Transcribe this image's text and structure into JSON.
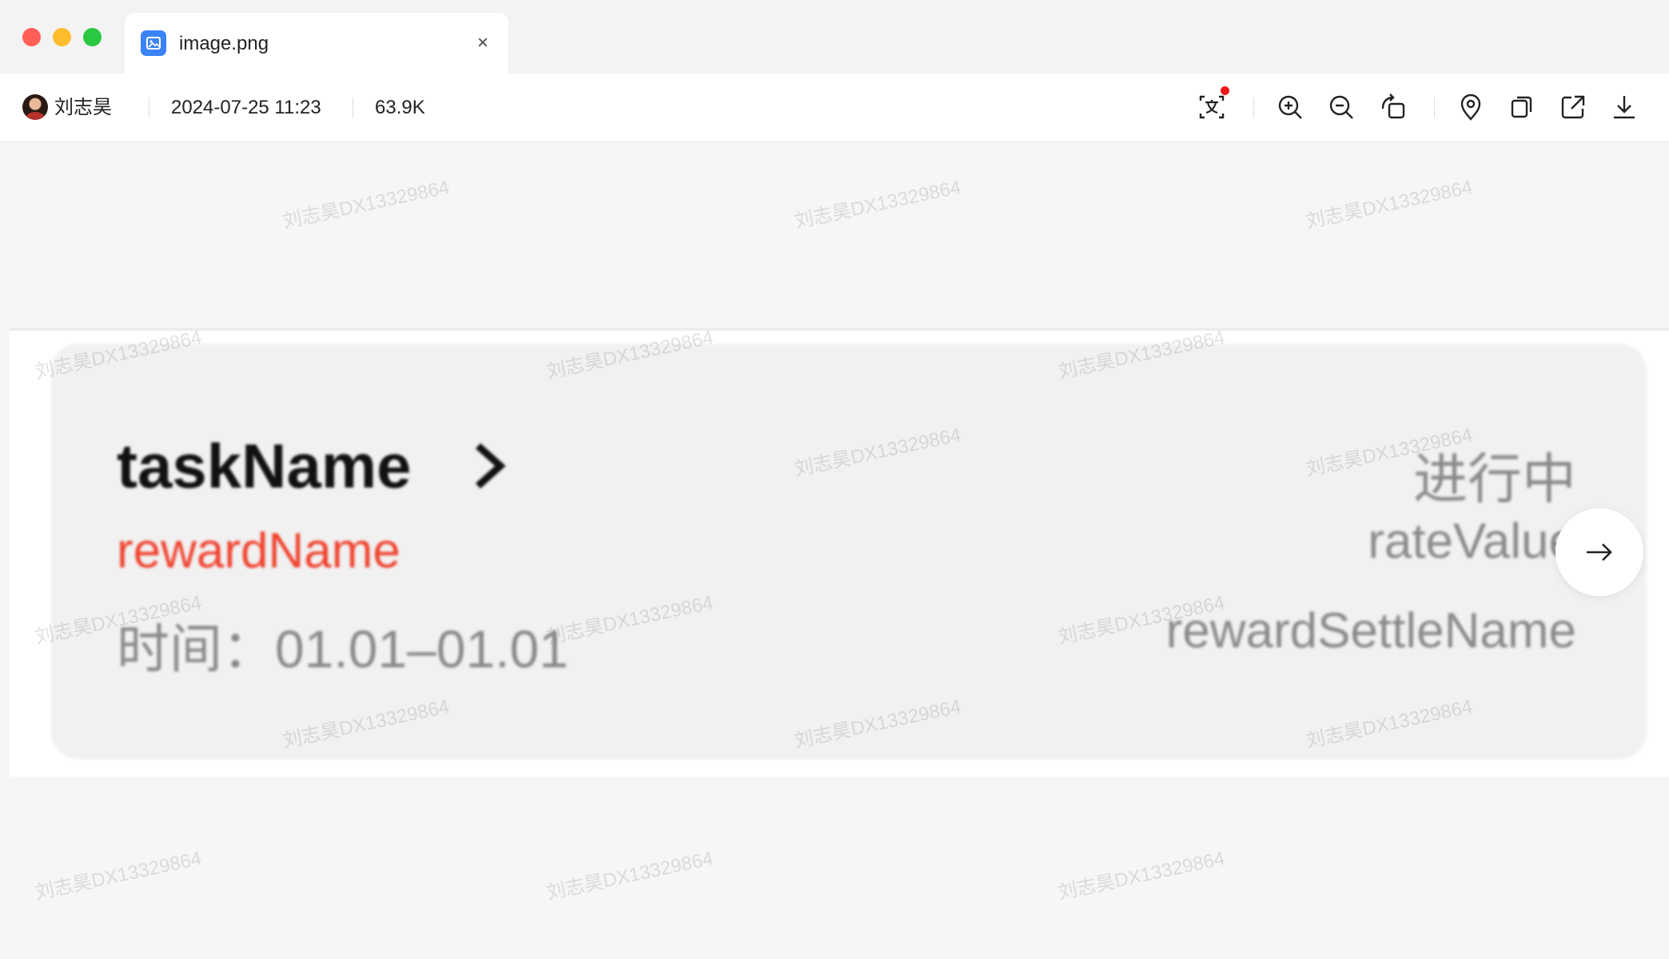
{
  "tab": {
    "title": "image.png",
    "close_glyph": "×"
  },
  "toolbar": {
    "uploader": "刘志昊",
    "datetime": "2024-07-25 11:23",
    "file_size": "63.9K",
    "tools": [
      "ocr-translate-icon",
      "zoom-in-icon",
      "zoom-out-icon",
      "rotate-icon",
      "locate-icon",
      "copy-icon",
      "open-external-icon",
      "download-icon"
    ]
  },
  "image_content": {
    "task_name": "taskName",
    "reward_name": "rewardName",
    "time_label": "时间：",
    "time_range": "01.01–01.01",
    "status": "进行中",
    "rate_value": "rateValue",
    "reward_settle_name": "rewardSettleName"
  },
  "watermark": {
    "text": "刘志昊DX13329864"
  },
  "colors": {
    "accent_blue": "#3b82f6",
    "reward_red": "#f0422e",
    "notification_dot": "#f01818"
  }
}
